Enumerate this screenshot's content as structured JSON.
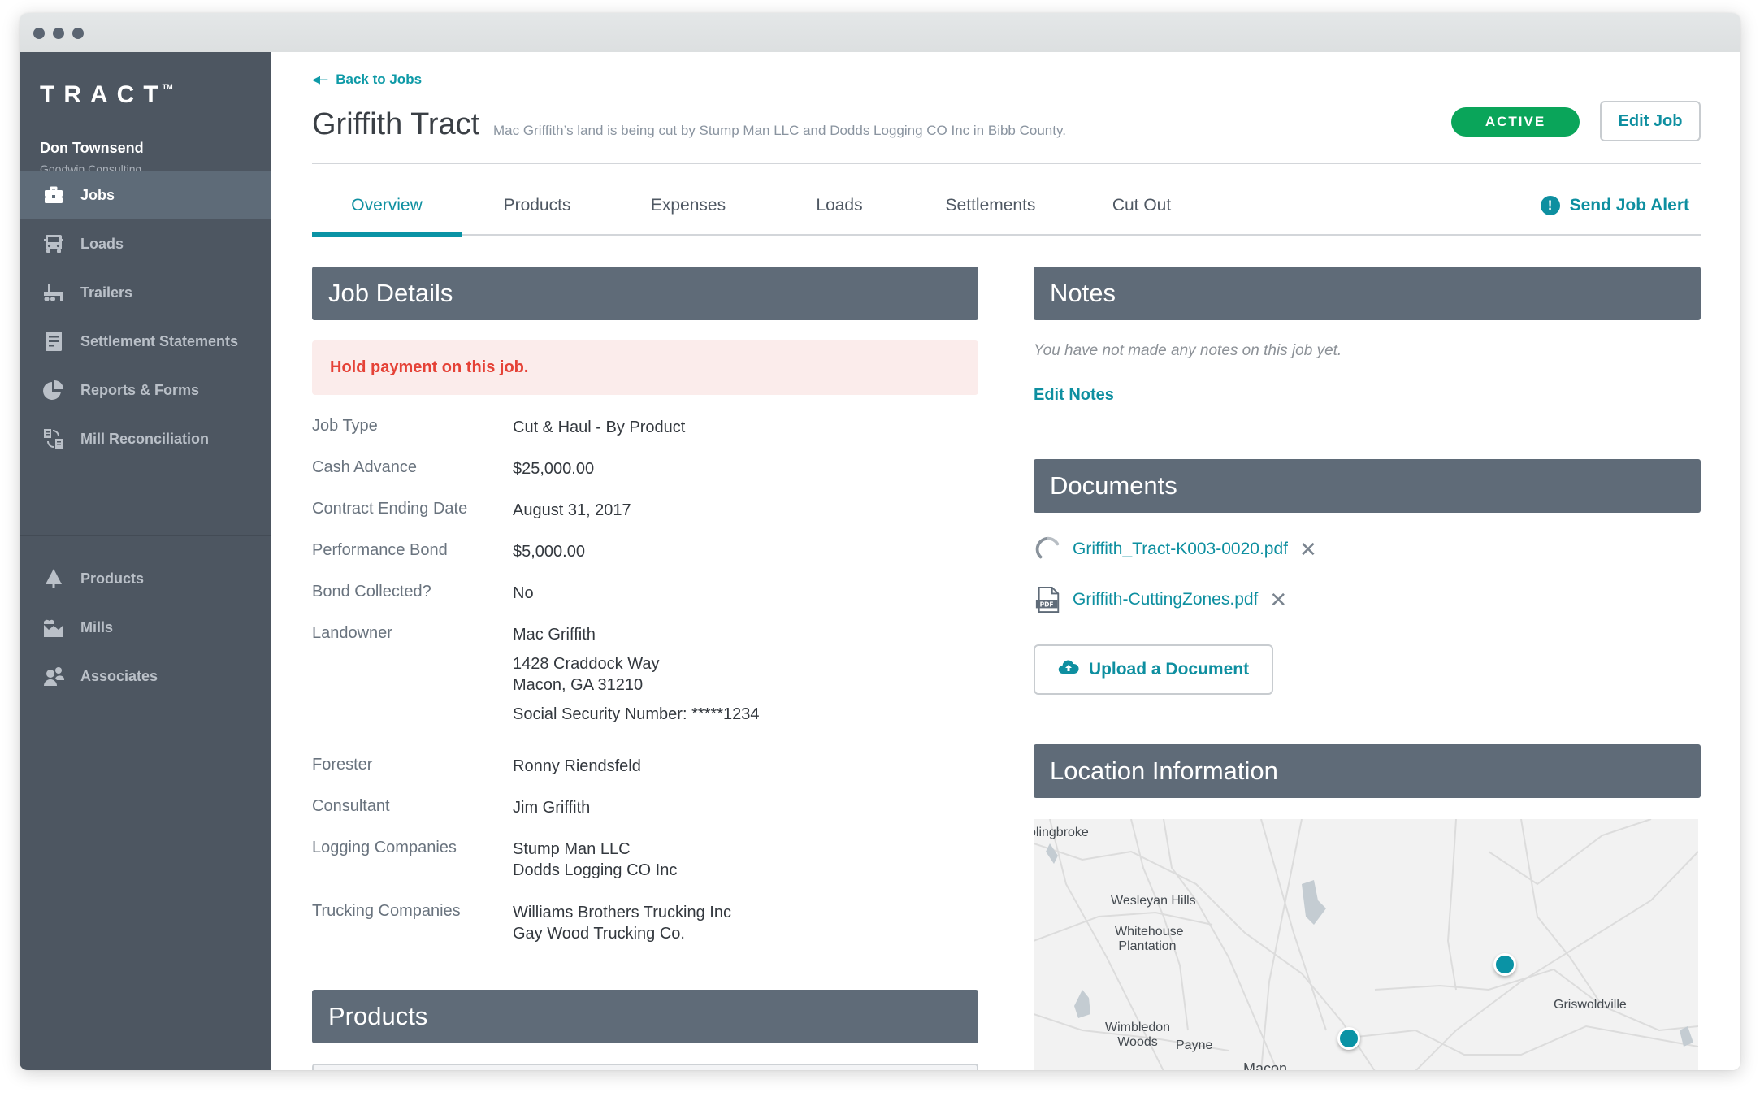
{
  "window": {
    "controls": [
      "close",
      "minimize",
      "maximize"
    ]
  },
  "sidebar": {
    "logo": "TRACT",
    "logo_mark": "TM",
    "user": {
      "name": "Don Townsend",
      "organization": "Goodwin Consulting"
    },
    "items": [
      {
        "label": "Jobs",
        "icon": "briefcase-icon",
        "active": true
      },
      {
        "label": "Loads",
        "icon": "truck-icon",
        "active": false
      },
      {
        "label": "Trailers",
        "icon": "trailer-icon",
        "active": false
      },
      {
        "label": "Settlement Statements",
        "icon": "document-icon",
        "active": false
      },
      {
        "label": "Reports & Forms",
        "icon": "pie-chart-icon",
        "active": false
      },
      {
        "label": "Mill Reconciliation",
        "icon": "reconcile-icon",
        "active": false
      }
    ],
    "secondary_items": [
      {
        "label": "Products",
        "icon": "tree-icon"
      },
      {
        "label": "Mills",
        "icon": "factory-icon"
      },
      {
        "label": "Associates",
        "icon": "people-icon"
      }
    ]
  },
  "header": {
    "back_link": "Back to Jobs",
    "title": "Griffith Tract",
    "subtitle": "Mac Griffith’s land is being cut by Stump Man LLC and Dodds Logging CO Inc  in Bibb County.",
    "status": "ACTIVE",
    "status_color": "#0aa55a",
    "edit_button": "Edit Job"
  },
  "tabs": [
    {
      "label": "Overview",
      "active": true
    },
    {
      "label": "Products",
      "active": false
    },
    {
      "label": "Expenses",
      "active": false
    },
    {
      "label": "Loads",
      "active": false
    },
    {
      "label": "Settlements",
      "active": false
    },
    {
      "label": "Cut Out",
      "active": false
    }
  ],
  "send_alert": "Send Job Alert",
  "job_details": {
    "title": "Job Details",
    "hold_message": "Hold payment on this job.",
    "rows": [
      {
        "label": "Job Type",
        "value": [
          "Cut & Haul - By Product"
        ]
      },
      {
        "label": "Cash Advance",
        "value": [
          "$25,000.00"
        ]
      },
      {
        "label": "Contract Ending Date",
        "value": [
          "August 31, 2017"
        ]
      },
      {
        "label": "Performance Bond",
        "value": [
          "$5,000.00"
        ]
      },
      {
        "label": "Bond Collected?",
        "value": [
          "No"
        ]
      },
      {
        "label": "Landowner",
        "value": [
          "Mac Griffith"
        ],
        "address": [
          "1428 Craddock Way",
          "Macon, GA 31210"
        ],
        "ssn": "Social Security Number: *****1234"
      },
      {
        "label": "Forester",
        "value": [
          "Ronny Riendsfeld"
        ]
      },
      {
        "label": "Consultant",
        "value": [
          "Jim Griffith"
        ]
      },
      {
        "label": "Logging Companies",
        "value": [
          "Stump Man LLC",
          "Dodds Logging CO Inc"
        ]
      },
      {
        "label": "Trucking Companies",
        "value": [
          "Williams Brothers Trucking Inc",
          "Gay Wood Trucking Co."
        ]
      }
    ]
  },
  "products": {
    "title": "Products"
  },
  "notes": {
    "title": "Notes",
    "empty_message": "You have not made any notes on this job yet.",
    "edit_link": "Edit Notes"
  },
  "documents": {
    "title": "Documents",
    "files": [
      {
        "name": "Griffith_Tract-K003-0020.pdf",
        "state": "uploading"
      },
      {
        "name": "Griffith-CuttingZones.pdf",
        "state": "uploaded",
        "type": "PDF"
      }
    ],
    "upload_button": "Upload a Document"
  },
  "location": {
    "title": "Location Information",
    "map_labels": [
      "olingbroke",
      "Wesleyan Hills",
      "Whitehouse Plantation",
      "Wimbledon Woods",
      "Payne",
      "Griswoldville",
      "Macon"
    ],
    "pins": 2
  },
  "colors": {
    "accent": "#0e8fa0",
    "sidebar_bg": "#4d5661",
    "section_header_bg": "#5f6b78",
    "alert_text": "#e54237",
    "alert_bg": "#fbeceb"
  }
}
